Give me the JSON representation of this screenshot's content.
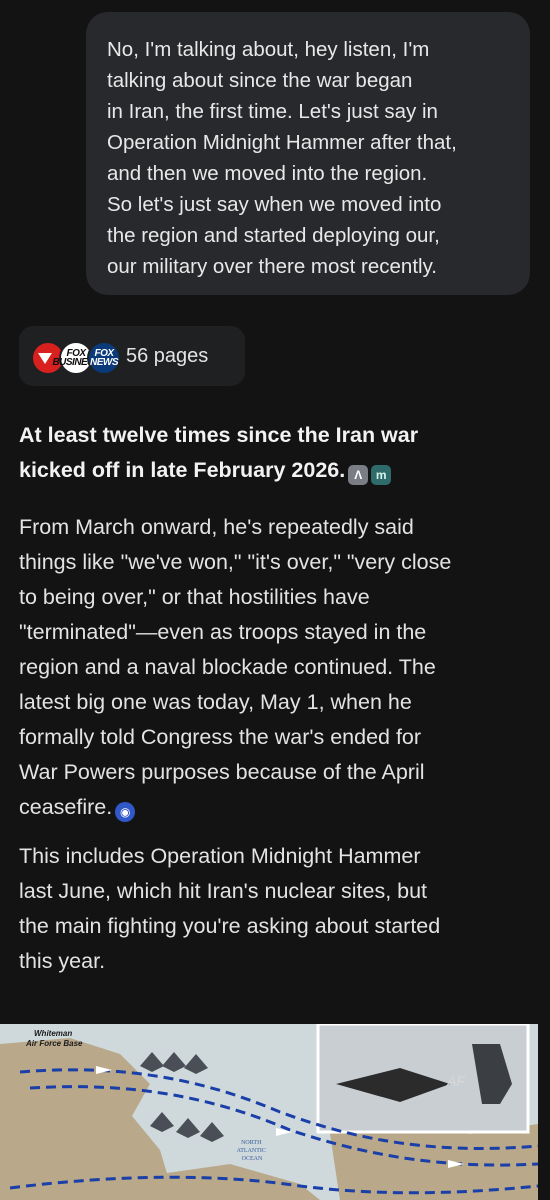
{
  "user_message": {
    "lines": [
      "No, I'm talking about, hey listen, I'm",
      "talking about since the war began",
      "in Iran, the first time. Let's just say in",
      "Operation Midnight Hammer after that,",
      "and then we moved into the region.",
      "So let's just say when we moved into",
      "the region and started deploying our,",
      "our military over there most recently."
    ]
  },
  "sources": {
    "label": "56 pages",
    "icons": [
      {
        "name": "red-play-logo",
        "text": ""
      },
      {
        "name": "fox-business-logo",
        "text": "FOX BUSINESS"
      },
      {
        "name": "fox-news-logo",
        "text": "FOX NEWS"
      }
    ]
  },
  "answer": {
    "headline_lines": [
      "At least twelve times since the Iran war",
      "kicked off in late February 2026."
    ],
    "headline_citations": [
      "Λ",
      "m"
    ],
    "paragraph1_lines": [
      "From March onward, he's repeatedly said",
      "things like \"we've won,\" \"it's over,\" \"very close",
      "to being over,\" or that hostilities have",
      "\"terminated\"—even as troops stayed in the",
      "region and a naval blockade continued. The",
      "latest big one was today, May 1, when he",
      "formally told Congress the war's ended for",
      "War Powers purposes because of the April",
      "ceasefire."
    ],
    "paragraph1_citation": "◉",
    "paragraph2_lines": [
      "This includes Operation Midnight Hammer",
      "last June, which hit Iran's nuclear sites, but",
      "the main fighting you're asking about started",
      "this year."
    ]
  },
  "map_image": {
    "labels": {
      "base": "Whiteman\nAir Force Base",
      "ocean": "NORTH\nATLANTIC\nOCEAN",
      "aircraft_text": "AF"
    },
    "colors": {
      "land": "#b9a98a",
      "sea": "#cfd9dc",
      "route": "#1a3fa8",
      "sky": "#c9ced2"
    }
  }
}
